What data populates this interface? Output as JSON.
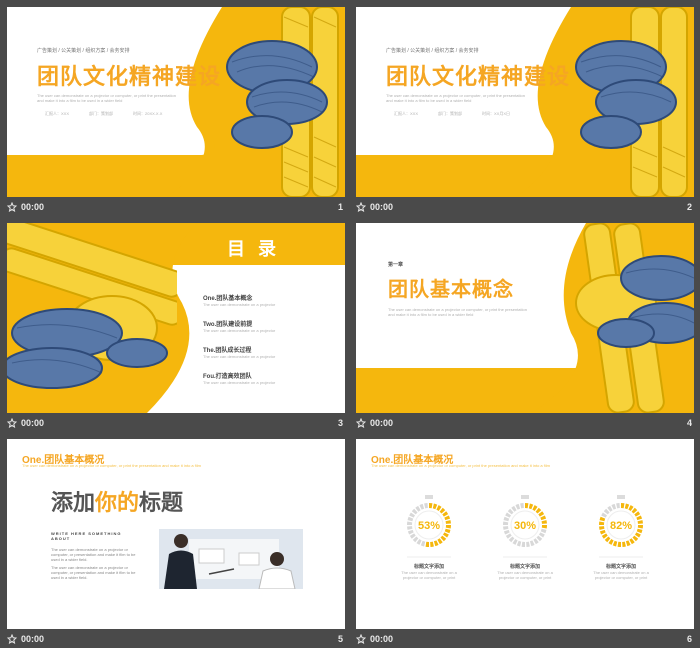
{
  "colors": {
    "accent": "#f5b70d",
    "orange": "#f5a623",
    "gray_text": "#555555",
    "bg": "#4a4a4a"
  },
  "timer_text": "00:00",
  "slides": [
    {
      "number": "1",
      "tags": "广告策划 / 公关策划 / 组织方案 / 会务安排",
      "title": "团队文化精神建设",
      "desc": [
        "The user can demonstrate on a projector or computer, or print the presentation",
        "and make it into a film to be used in a wider field"
      ],
      "info": [
        "汇报人：XXX",
        "部门：策划部",
        "时间：20XX.X.X"
      ]
    },
    {
      "number": "2",
      "tags": "广告策划 / 公关策划 / 组织方案 / 会务安排",
      "title": "团队文化精神建设",
      "desc": [
        "The user can demonstrate on a projector or computer, or print the presentation",
        "and make it into a film to be used in a wider field"
      ],
      "info": [
        "汇报人：XXX",
        "部门：策划部",
        "时间：XX月X日"
      ]
    },
    {
      "number": "3",
      "title": "目 录",
      "items": [
        {
          "label": "One.团队基本概念",
          "sub": "The user can demonstrate on a projector"
        },
        {
          "label": "Two.团队建设前提",
          "sub": "The user can demonstrate on a projector"
        },
        {
          "label": "The.团队成长过程",
          "sub": "The user can demonstrate on a projector"
        },
        {
          "label": "Fou.打造高效团队",
          "sub": "The user can demonstrate on a projector"
        }
      ]
    },
    {
      "number": "4",
      "chapter": "第一章",
      "title": "团队基本概念",
      "desc": [
        "The user can demonstrate on a projector or computer, or print the presentation",
        "and make it into a film to be used in a wider field"
      ]
    },
    {
      "number": "5",
      "header": "One.团队基本概况",
      "header_sub": "The user can demonstrate on a projector or computer, or print the presentation and make it into a film",
      "headline_a": "添加",
      "headline_b": "你的",
      "headline_c": "标题",
      "write_label": [
        "WRITE HERE SOMETHING",
        "ABOUT"
      ],
      "paras": [
        [
          "The user can demonstrate on a projector or",
          "computer, or presentation and make it film to be",
          "used in a wider field."
        ],
        [
          "The user can demonstrate on a projector or",
          "computer, or presentation and make it film to be",
          "used in a wider field."
        ]
      ]
    },
    {
      "number": "6",
      "header": "One.团队基本概况",
      "header_sub": "The user can demonstrate on a projector or computer, or print the presentation and make it into a film",
      "gauges": [
        {
          "value": 53,
          "label": "53%",
          "title": "标题文字添加",
          "sub": [
            "The user can demonstrate on a",
            "projector or computer, or print"
          ]
        },
        {
          "value": 30,
          "label": "30%",
          "title": "标题文字添加",
          "sub": [
            "The user can demonstrate on a",
            "projector or computer, or print"
          ]
        },
        {
          "value": 82,
          "label": "82%",
          "title": "标题文字添加",
          "sub": [
            "The user can demonstrate on a",
            "projector or computer, or print"
          ]
        }
      ]
    }
  ]
}
